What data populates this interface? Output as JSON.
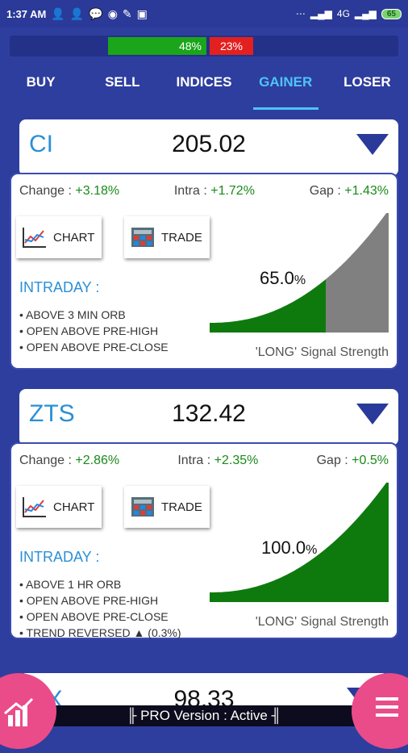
{
  "status": {
    "time": "1:37 AM",
    "network": "4G",
    "battery": "65"
  },
  "breadth": {
    "up_label": "48%",
    "down_label": "23%"
  },
  "tabs": [
    "BUY",
    "SELL",
    "INDICES",
    "GAINER",
    "LOSER"
  ],
  "active_tab": "GAINER",
  "cards": [
    {
      "symbol": "CI",
      "price": "205.02",
      "change_label": "Change : ",
      "change": "+3.18%",
      "intra_label": "Intra : ",
      "intra": "+1.72%",
      "gap_label": "Gap : ",
      "gap": "+1.43%",
      "chart_btn": "CHART",
      "trade_btn": "TRADE",
      "intraday_label": "INTRADAY :",
      "signals": [
        "• ABOVE 3 MIN ORB",
        "• OPEN ABOVE PRE-HIGH",
        "• OPEN ABOVE PRE-CLOSE"
      ],
      "strength_value": "65.0",
      "strength_unit": "%",
      "strength_fraction": 0.65,
      "signal_label": "'LONG' Signal Strength"
    },
    {
      "symbol": "ZTS",
      "price": "132.42",
      "change_label": "Change : ",
      "change": "+2.86%",
      "intra_label": "Intra : ",
      "intra": "+2.35%",
      "gap_label": "Gap : ",
      "gap": "+0.5%",
      "chart_btn": "CHART",
      "trade_btn": "TRADE",
      "intraday_label": "INTRADAY :",
      "signals": [
        "• ABOVE 1 HR ORB",
        "• OPEN ABOVE PRE-HIGH",
        "• OPEN ABOVE PRE-CLOSE",
        "• TREND REVERSED ▲ (0.3%)"
      ],
      "strength_value": "100.0",
      "strength_unit": "%",
      "strength_fraction": 1.0,
      "signal_label": "'LONG' Signal Strength"
    }
  ],
  "peek": {
    "symbol": "NX",
    "price": "98.33"
  },
  "pro_label": "╟ PRO Version : Active ╢",
  "colors": {
    "accent": "#2e3e9e",
    "gain": "#1a8a1a",
    "strength_fill": "#0e7a0e",
    "strength_rest": "#808080",
    "fab": "#ea4c8a"
  }
}
